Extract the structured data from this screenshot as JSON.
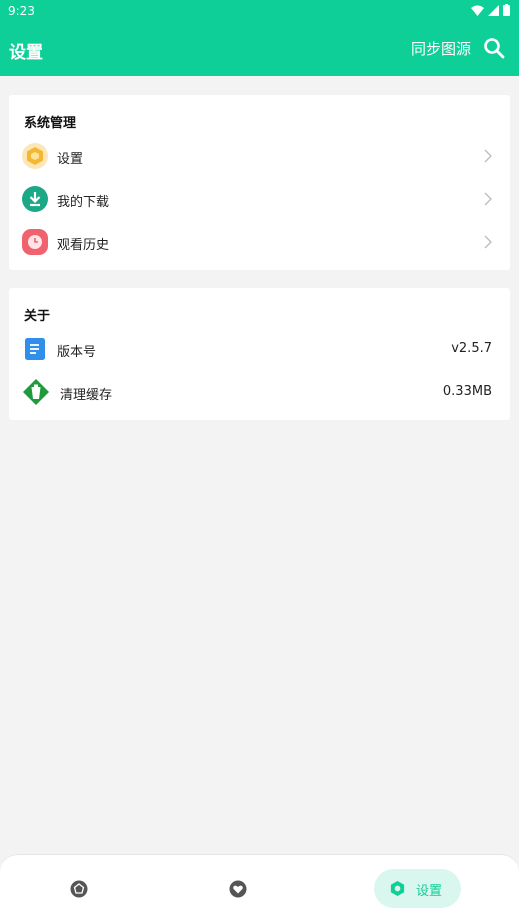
{
  "status_bar": {
    "time": "9:23"
  },
  "app_bar": {
    "title": "设置",
    "sync_label": "同步图源"
  },
  "system_section": {
    "title": "系统管理",
    "items": [
      {
        "label": "设置",
        "icon": "hexagon-settings-icon",
        "color": "#f5b731"
      },
      {
        "label": "我的下载",
        "icon": "download-icon",
        "color": "#1aa886"
      },
      {
        "label": "观看历史",
        "icon": "history-clock-icon",
        "color": "#f0626e"
      }
    ]
  },
  "about_section": {
    "title": "关于",
    "items": [
      {
        "label": "版本号",
        "value": "v2.5.7",
        "icon": "document-icon",
        "color": "#2f8fea"
      },
      {
        "label": "清理缓存",
        "value": "0.33MB",
        "icon": "broom-cache-icon",
        "color": "#1f9a3f"
      }
    ]
  },
  "bottom_nav": {
    "items": [
      {
        "icon": "home-icon"
      },
      {
        "icon": "heart-icon"
      },
      {
        "icon": "settings-icon",
        "label": "设置",
        "active": true
      }
    ]
  },
  "colors": {
    "accent": "#0fcf98",
    "background": "#f3f3f3"
  }
}
